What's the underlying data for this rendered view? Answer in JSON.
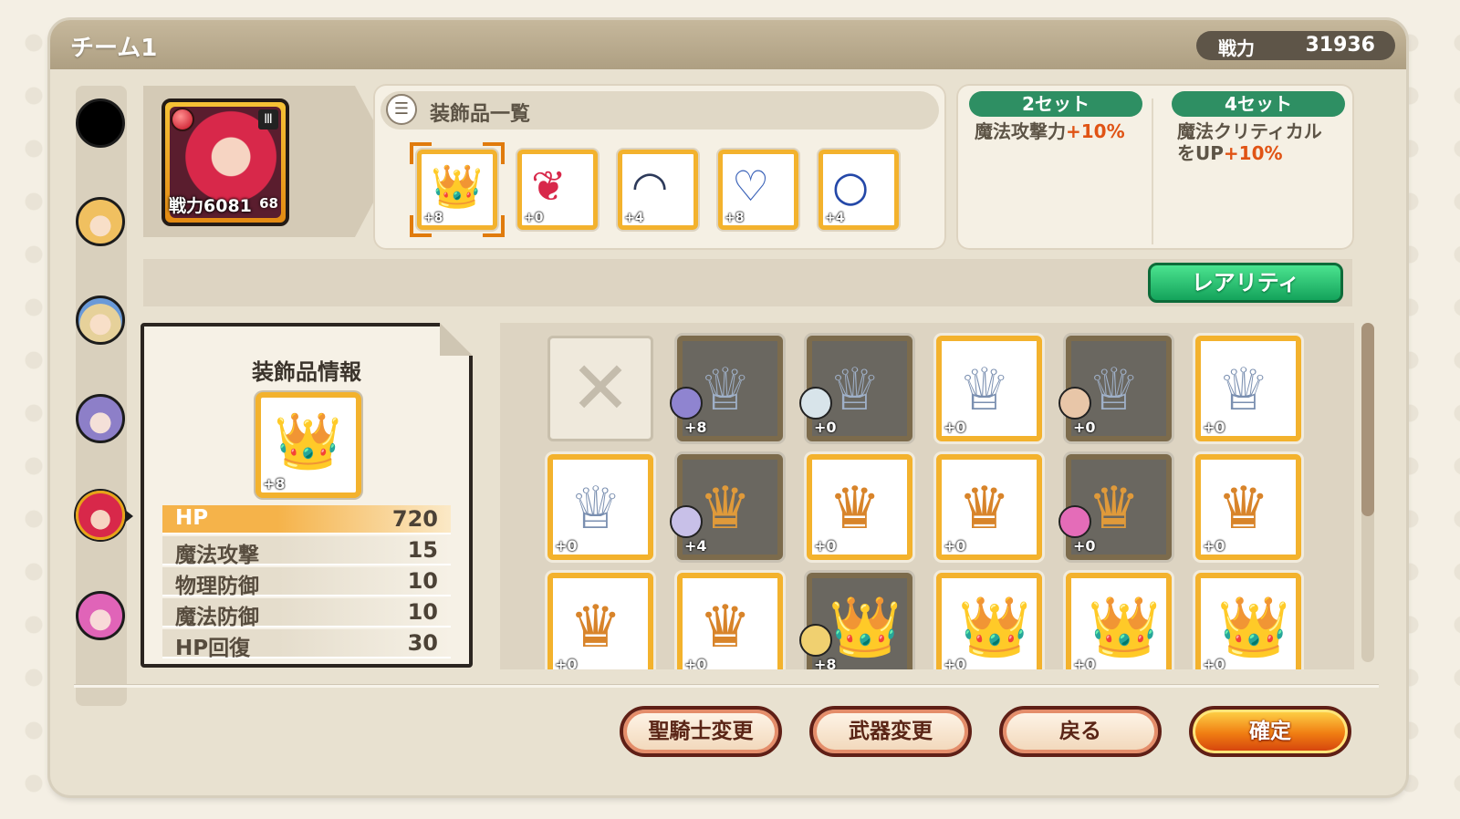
{
  "header": {
    "title": "チーム1",
    "power_label": "戦力",
    "power_value": "31936"
  },
  "character": {
    "power_text": "戦力6081",
    "level": "68"
  },
  "accessory_list": {
    "title": "装飾品一覧",
    "slots": [
      {
        "icon": "tiara-icon",
        "plus": "+8",
        "selected": true
      },
      {
        "icon": "earrings-icon",
        "plus": "+0"
      },
      {
        "icon": "necklace-icon",
        "plus": "+4"
      },
      {
        "icon": "bracelet-icon",
        "plus": "+8"
      },
      {
        "icon": "ring-icon",
        "plus": "+4"
      }
    ]
  },
  "set_bonus": {
    "two": {
      "label": "2セット",
      "text": "魔法攻撃力",
      "value": "+10%"
    },
    "four": {
      "label": "4セット",
      "text_line1": "魔法クリティカル",
      "text_line2": "をUP",
      "value": "+10%"
    }
  },
  "filter": {
    "rarity_button": "レアリティ"
  },
  "info": {
    "title": "装飾品情報",
    "item_plus": "+8",
    "stats": [
      {
        "name": "HP",
        "value": "720"
      },
      {
        "name": "魔法攻撃",
        "value": "15"
      },
      {
        "name": "物理防御",
        "value": "10"
      },
      {
        "name": "魔法防御",
        "value": "10"
      },
      {
        "name": "HP回復",
        "value": "30"
      }
    ]
  },
  "grid": {
    "rows": [
      [
        {
          "type": "empty"
        },
        {
          "type": "tiara-green",
          "plus": "+8",
          "equipped": true
        },
        {
          "type": "tiara-green",
          "plus": "+0",
          "equipped": true
        },
        {
          "type": "tiara-green",
          "plus": "+0"
        },
        {
          "type": "tiara-green",
          "plus": "+0",
          "equipped": true
        },
        {
          "type": "tiara-green",
          "plus": "+0"
        }
      ],
      [
        {
          "type": "tiara-green",
          "plus": "+0"
        },
        {
          "type": "tiara-gold",
          "plus": "+4",
          "equipped": true
        },
        {
          "type": "tiara-gold",
          "plus": "+0"
        },
        {
          "type": "tiara-gold",
          "plus": "+0"
        },
        {
          "type": "tiara-gold",
          "plus": "+0",
          "equipped": true
        },
        {
          "type": "tiara-gold",
          "plus": "+0"
        }
      ],
      [
        {
          "type": "tiara-gold",
          "plus": "+0"
        },
        {
          "type": "tiara-gold",
          "plus": "+0"
        },
        {
          "type": "tiara-blue",
          "plus": "+8",
          "equipped": true
        },
        {
          "type": "tiara-blue",
          "plus": "+0"
        },
        {
          "type": "tiara-blue",
          "plus": "+0"
        },
        {
          "type": "tiara-blue",
          "plus": "+0"
        }
      ]
    ]
  },
  "buttons": {
    "knight": "聖騎士変更",
    "weapon": "武器変更",
    "back": "戻る",
    "confirm": "確定"
  },
  "colors": {
    "accent_orange": "#f3b22d",
    "set_green": "#2e8f63",
    "highlight": "#e05314",
    "rarity_green": "#14a35b"
  }
}
